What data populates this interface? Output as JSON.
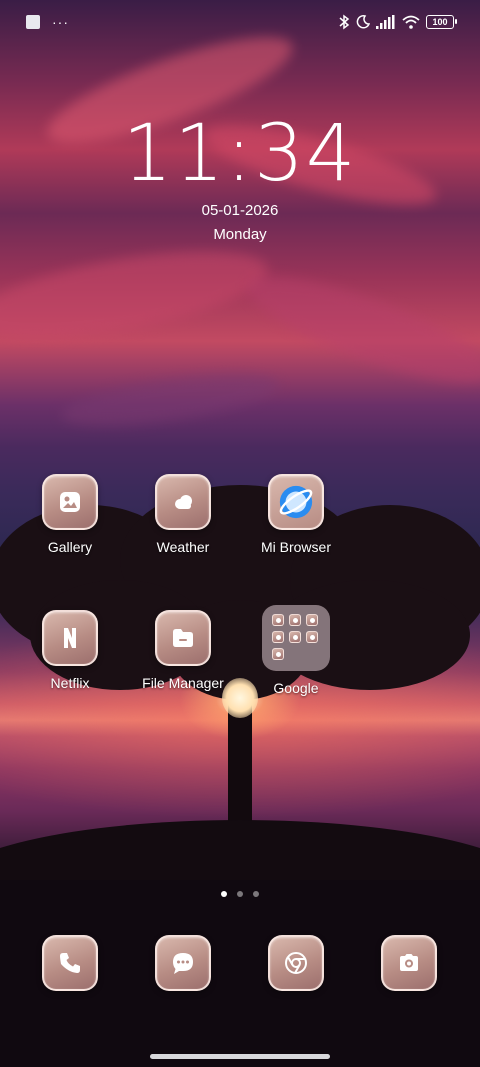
{
  "status_bar": {
    "left_icons": [
      "screenshot-icon",
      "more-dots-icon"
    ],
    "more_text": "···",
    "right_icons": [
      "bluetooth-icon",
      "moon-icon",
      "signal-icon",
      "wifi-icon",
      "battery-icon"
    ],
    "battery_level": "100"
  },
  "lockclock": {
    "time": "11:34",
    "date": "05-01-2026",
    "weekday": "Monday"
  },
  "home": {
    "apps": [
      {
        "label": "Gallery",
        "icon": "gallery-icon"
      },
      {
        "label": "Weather",
        "icon": "cloud-icon"
      },
      {
        "label": "Mi Browser",
        "icon": "browser-planet-icon"
      },
      {
        "label": "Netflix",
        "icon": "netflix-n-icon"
      },
      {
        "label": "File Manager",
        "icon": "folder-icon"
      },
      {
        "label": "Google",
        "icon": "folder-grid-icon"
      }
    ],
    "page_indicator": {
      "pages": 3,
      "active": 0
    }
  },
  "dock": [
    {
      "icon": "phone-icon"
    },
    {
      "icon": "message-icon"
    },
    {
      "icon": "chrome-icon"
    },
    {
      "icon": "camera-icon"
    }
  ],
  "colors": {
    "icon_tile": "#b78c84",
    "text": "#ffffff"
  }
}
